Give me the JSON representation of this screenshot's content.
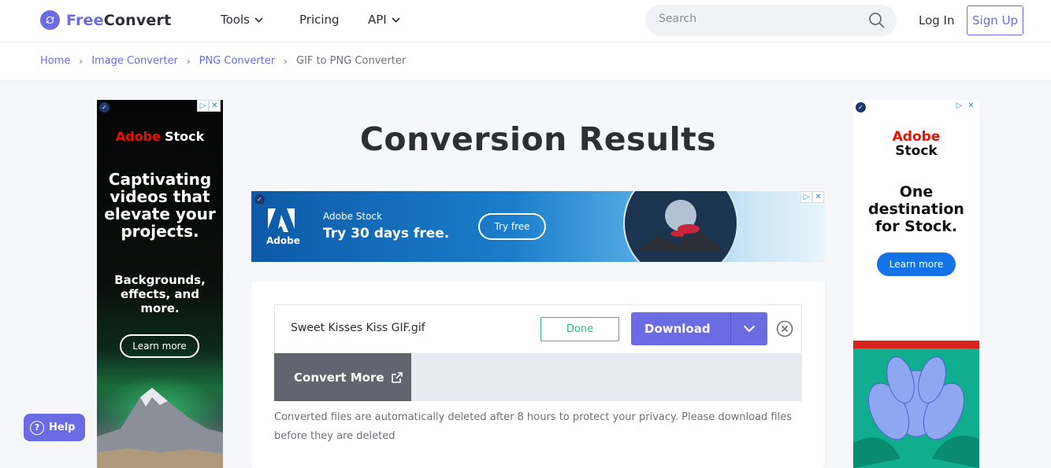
{
  "header": {
    "logo_free": "Free",
    "logo_convert": "Convert",
    "nav": [
      {
        "label": "Tools"
      },
      {
        "label": "Pricing"
      },
      {
        "label": "API"
      }
    ],
    "search_placeholder": "Search",
    "login": "Log In",
    "signup": "Sign Up"
  },
  "breadcrumb": [
    "Home",
    "Image Converter",
    "PNG Converter",
    "GIF to PNG Converter"
  ],
  "ads": {
    "left": {
      "brand_adobe": "Adobe",
      "brand_stock": "Stock",
      "headline": "Captivating videos that elevate your projects.",
      "subline": "Backgrounds, effects, and more.",
      "cta": "Learn more"
    },
    "banner": {
      "logo_text": "Adobe",
      "brand": "Adobe Stock",
      "headline": "Try 30 days free.",
      "cta": "Try free"
    },
    "right": {
      "brand_adobe": "Adobe",
      "brand_stock": "Stock",
      "headline": "One destination for Stock.",
      "cta": "Learn more"
    }
  },
  "main": {
    "title": "Conversion Results",
    "file_name": "Sweet Kisses Kiss GIF.gif",
    "status": "Done",
    "download_label": "Download",
    "convert_more_label": "Convert More",
    "notice": "Converted files are automatically deleted after 8 hours to protect your privacy. Please download files before they are deleted"
  },
  "help_label": "Help",
  "colors": {
    "accent": "#6b6be4",
    "success": "#2bbd7e",
    "text": "#2c2f36",
    "muted": "#6d7079"
  }
}
